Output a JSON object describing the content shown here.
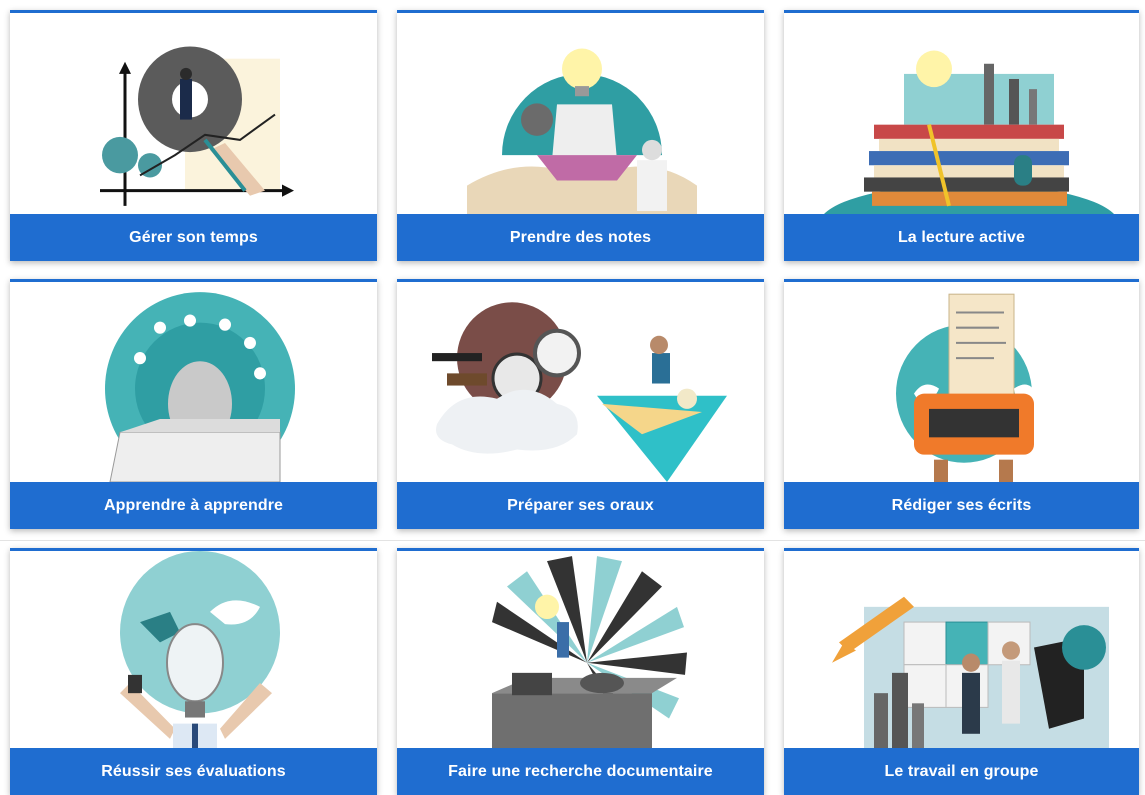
{
  "colors": {
    "accent_blue": "#1f6dd0",
    "teal": "#45b3b6",
    "light_teal": "#8fd0d2",
    "dark_grey": "#555555",
    "orange": "#f08a24"
  },
  "cards": [
    {
      "label": "Gérer son temps",
      "icon": "time-management-illustration"
    },
    {
      "label": "Prendre des notes",
      "icon": "note-taking-illustration"
    },
    {
      "label": "La lecture active",
      "icon": "active-reading-illustration"
    },
    {
      "label": "Apprendre à apprendre",
      "icon": "learning-to-learn-illustration"
    },
    {
      "label": "Préparer ses oraux",
      "icon": "oral-preparation-illustration"
    },
    {
      "label": "Rédiger ses écrits",
      "icon": "writing-illustration"
    },
    {
      "label": "Réussir ses évaluations",
      "icon": "exam-success-illustration"
    },
    {
      "label": "Faire une recherche documentaire",
      "icon": "documentary-research-illustration"
    },
    {
      "label": "Le travail en groupe",
      "icon": "group-work-illustration"
    }
  ]
}
